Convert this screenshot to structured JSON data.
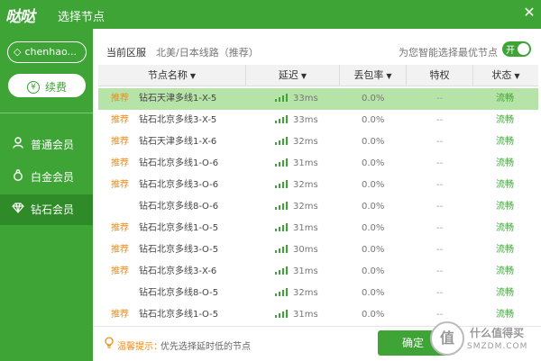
{
  "window": {
    "logo": "哒哒",
    "title": "选择节点",
    "close_glyph": "✕"
  },
  "sidebar": {
    "username": "chenhao...",
    "renew_label": "续费",
    "renew_icon_glyph": "¥",
    "items": [
      {
        "label": "普通会员",
        "icon": "user-icon"
      },
      {
        "label": "白金会员",
        "icon": "bag-icon"
      },
      {
        "label": "钻石会员",
        "icon": "diamond-icon",
        "active": true
      }
    ]
  },
  "header": {
    "region_label": "当前区服",
    "region_value": "北美/日本线路（推荐）",
    "smart_label": "为您智能选择最优节点",
    "toggle_label": "开"
  },
  "table": {
    "columns": [
      "节点名称",
      "延迟",
      "丢包率",
      "特权",
      "状态"
    ],
    "rows": [
      {
        "rec": "推荐",
        "name": "钻石天津多线1-X-5",
        "latency": "33ms",
        "loss": "0.0%",
        "priv": "--",
        "status": "流畅",
        "selected": true
      },
      {
        "rec": "推荐",
        "name": "钻石北京多线3-X-5",
        "latency": "33ms",
        "loss": "0.0%",
        "priv": "--",
        "status": "流畅"
      },
      {
        "rec": "推荐",
        "name": "钻石天津多线1-X-6",
        "latency": "32ms",
        "loss": "0.0%",
        "priv": "--",
        "status": "流畅"
      },
      {
        "rec": "推荐",
        "name": "钻石北京多线1-O-6",
        "latency": "31ms",
        "loss": "0.0%",
        "priv": "--",
        "status": "流畅"
      },
      {
        "rec": "推荐",
        "name": "钻石北京多线3-O-6",
        "latency": "32ms",
        "loss": "0.0%",
        "priv": "--",
        "status": "流畅"
      },
      {
        "rec": "",
        "name": "钻石北京多线8-O-6",
        "latency": "32ms",
        "loss": "0.0%",
        "priv": "--",
        "status": "流畅"
      },
      {
        "rec": "推荐",
        "name": "钻石北京多线1-O-5",
        "latency": "31ms",
        "loss": "0.0%",
        "priv": "--",
        "status": "流畅"
      },
      {
        "rec": "推荐",
        "name": "钻石北京多线3-O-5",
        "latency": "30ms",
        "loss": "0.0%",
        "priv": "--",
        "status": "流畅"
      },
      {
        "rec": "推荐",
        "name": "钻石北京多线3-X-6",
        "latency": "31ms",
        "loss": "0.0%",
        "priv": "--",
        "status": "流畅"
      },
      {
        "rec": "",
        "name": "钻石北京多线8-O-5",
        "latency": "32ms",
        "loss": "0.0%",
        "priv": "--",
        "status": "流畅"
      },
      {
        "rec": "推荐",
        "name": "钻石北京多线1-O-5",
        "latency": "31ms",
        "loss": "0.0%",
        "priv": "--",
        "status": "流畅"
      }
    ]
  },
  "footer": {
    "tip_label": "温馨提示：",
    "tip_text": "优先选择延时低的节点",
    "confirm_label": "确定"
  },
  "watermark": {
    "glyph": "值",
    "line1": "什么值得买",
    "line2": "SMZDM.COM"
  },
  "colors": {
    "brand_green": "#3da435",
    "recommend_orange": "#f08c18",
    "selected_row": "#b6e3a7"
  }
}
